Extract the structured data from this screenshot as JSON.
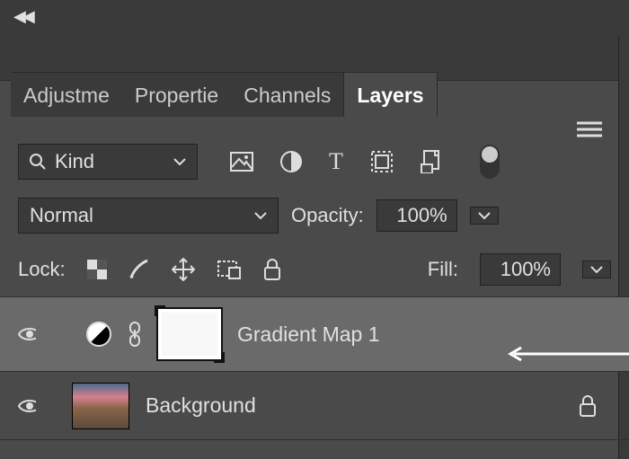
{
  "tabs": {
    "t0": "Adjustme",
    "t1": "Propertie",
    "t2": "Channels",
    "t3": "Layers"
  },
  "filter": {
    "type": "Kind"
  },
  "blend": {
    "mode": "Normal",
    "opacity_label": "Opacity:",
    "opacity_value": "100%"
  },
  "lock": {
    "label": "Lock:",
    "fill_label": "Fill:",
    "fill_value": "100%"
  },
  "layers": {
    "l0": "Gradient Map 1",
    "l1": "Background"
  }
}
